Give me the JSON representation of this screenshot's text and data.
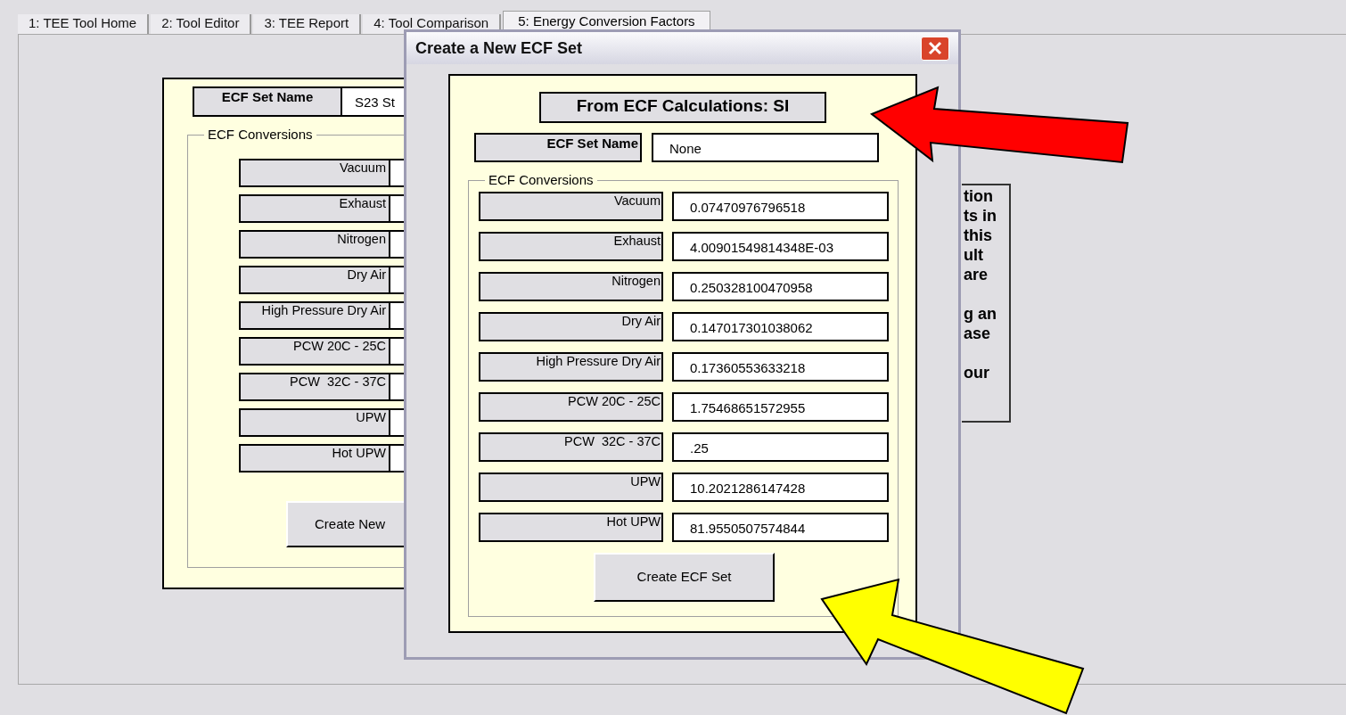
{
  "tabs": [
    {
      "label": "1: TEE Tool Home",
      "selected": false
    },
    {
      "label": "2: Tool Editor",
      "selected": false
    },
    {
      "label": "3: TEE Report",
      "selected": false
    },
    {
      "label": "4: Tool Comparison",
      "selected": false
    },
    {
      "label": "5: Energy Conversion Factors",
      "selected": true
    }
  ],
  "background_form": {
    "set_name_label": "ECF Set Name",
    "set_name_value": "S23 St",
    "group_label": "ECF Conversions",
    "conversions": [
      "Vacuum",
      "Exhaust",
      "Nitrogen",
      "Dry Air",
      "High Pressure Dry Air",
      "PCW 20C - 25C",
      "PCW  32C - 37C",
      "UPW",
      "Hot UPW"
    ],
    "button": "Create New"
  },
  "info_panel": {
    "paragraphs": [
      [
        "tion",
        "ts in",
        "this",
        "ult",
        "are"
      ],
      [
        "g an",
        "ase"
      ],
      [
        "our"
      ]
    ]
  },
  "dialog": {
    "title": "Create a New ECF Set",
    "heading": "From ECF Calculations: SI",
    "set_name_label": "ECF Set Name",
    "set_name_value": "None",
    "group_label": "ECF Conversions",
    "conversions": [
      {
        "label": "Vacuum",
        "value": "0.07470976796518"
      },
      {
        "label": "Exhaust",
        "value": "4.00901549814348E-03"
      },
      {
        "label": "Nitrogen",
        "value": "0.250328100470958"
      },
      {
        "label": "Dry Air",
        "value": "0.147017301038062"
      },
      {
        "label": "High Pressure Dry Air",
        "value": "0.17360553633218"
      },
      {
        "label": "PCW 20C - 25C",
        "value": "1.75468651572955"
      },
      {
        "label": "PCW  32C - 37C",
        "value": ".25"
      },
      {
        "label": "UPW",
        "value": "10.2021286147428"
      },
      {
        "label": "Hot UPW",
        "value": "81.9550507574844"
      }
    ],
    "button": "Create ECF Set"
  },
  "annotations": [
    {
      "kind": "arrow",
      "color": "#ff0000"
    },
    {
      "kind": "arrow",
      "color": "#ffff00"
    }
  ]
}
